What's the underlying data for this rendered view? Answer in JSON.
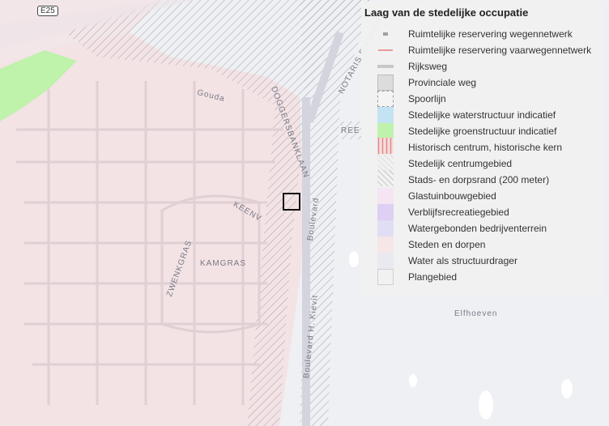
{
  "map": {
    "road_shield": "E25",
    "labels": {
      "gouda": "Gouda",
      "doggersbanklaan": "DOGGERSBANKLAAN",
      "notaris_d_aunerie": "NOTARIS D'AUNERIE",
      "ree": "REE",
      "kamgras": "KAMGRAS",
      "keenv": "KEENV",
      "zwenkgras": "ZWENKGRAS",
      "boulevard": "Boulevard",
      "boulevard_hildebrand": "Boulevard H. Kievit",
      "elfhoeven": "Elfhoeven"
    }
  },
  "legend": {
    "title": "Laag van de stedelijke occupatie",
    "items": [
      {
        "label": "Ruimtelijke reservering wegennetwerk",
        "symbol": "dash-grey"
      },
      {
        "label": "Ruimtelijke reservering vaarwegennetwerk",
        "symbol": "dash-red"
      },
      {
        "label": "Rijksweg",
        "symbol": "line-grey"
      },
      {
        "label": "Provinciale weg",
        "symbol": "box-grey"
      },
      {
        "label": "Spoorlijn",
        "symbol": "box-dashed"
      },
      {
        "label": "Stedelijke waterstructuur indicatief",
        "symbol": "fill",
        "color": "#c3e3f3"
      },
      {
        "label": "Stedelijke groenstructuur indicatief",
        "symbol": "fill",
        "color": "#bff2ab"
      },
      {
        "label": "Historisch centrum, historische kern",
        "symbol": "vstripe-red"
      },
      {
        "label": "Stedelijk centrumgebied",
        "symbol": "hatch-light"
      },
      {
        "label": "Stads- en dorpsrand (200 meter)",
        "symbol": "hatch-grey"
      },
      {
        "label": "Glastuinbouwgebied",
        "symbol": "fill",
        "color": "#f5e4f2"
      },
      {
        "label": "Verblijfsrecreatiegebied",
        "symbol": "fill",
        "color": "#ddd0f2"
      },
      {
        "label": "Watergebonden bedrijventerrein",
        "symbol": "fill",
        "color": "#e0def4"
      },
      {
        "label": "Steden en dorpen",
        "symbol": "fill",
        "color": "#f6e6e8"
      },
      {
        "label": "Water als structuurdrager",
        "symbol": "fill",
        "color": "#e9e9f0"
      },
      {
        "label": "Plangebied",
        "symbol": "box-outline"
      }
    ]
  }
}
